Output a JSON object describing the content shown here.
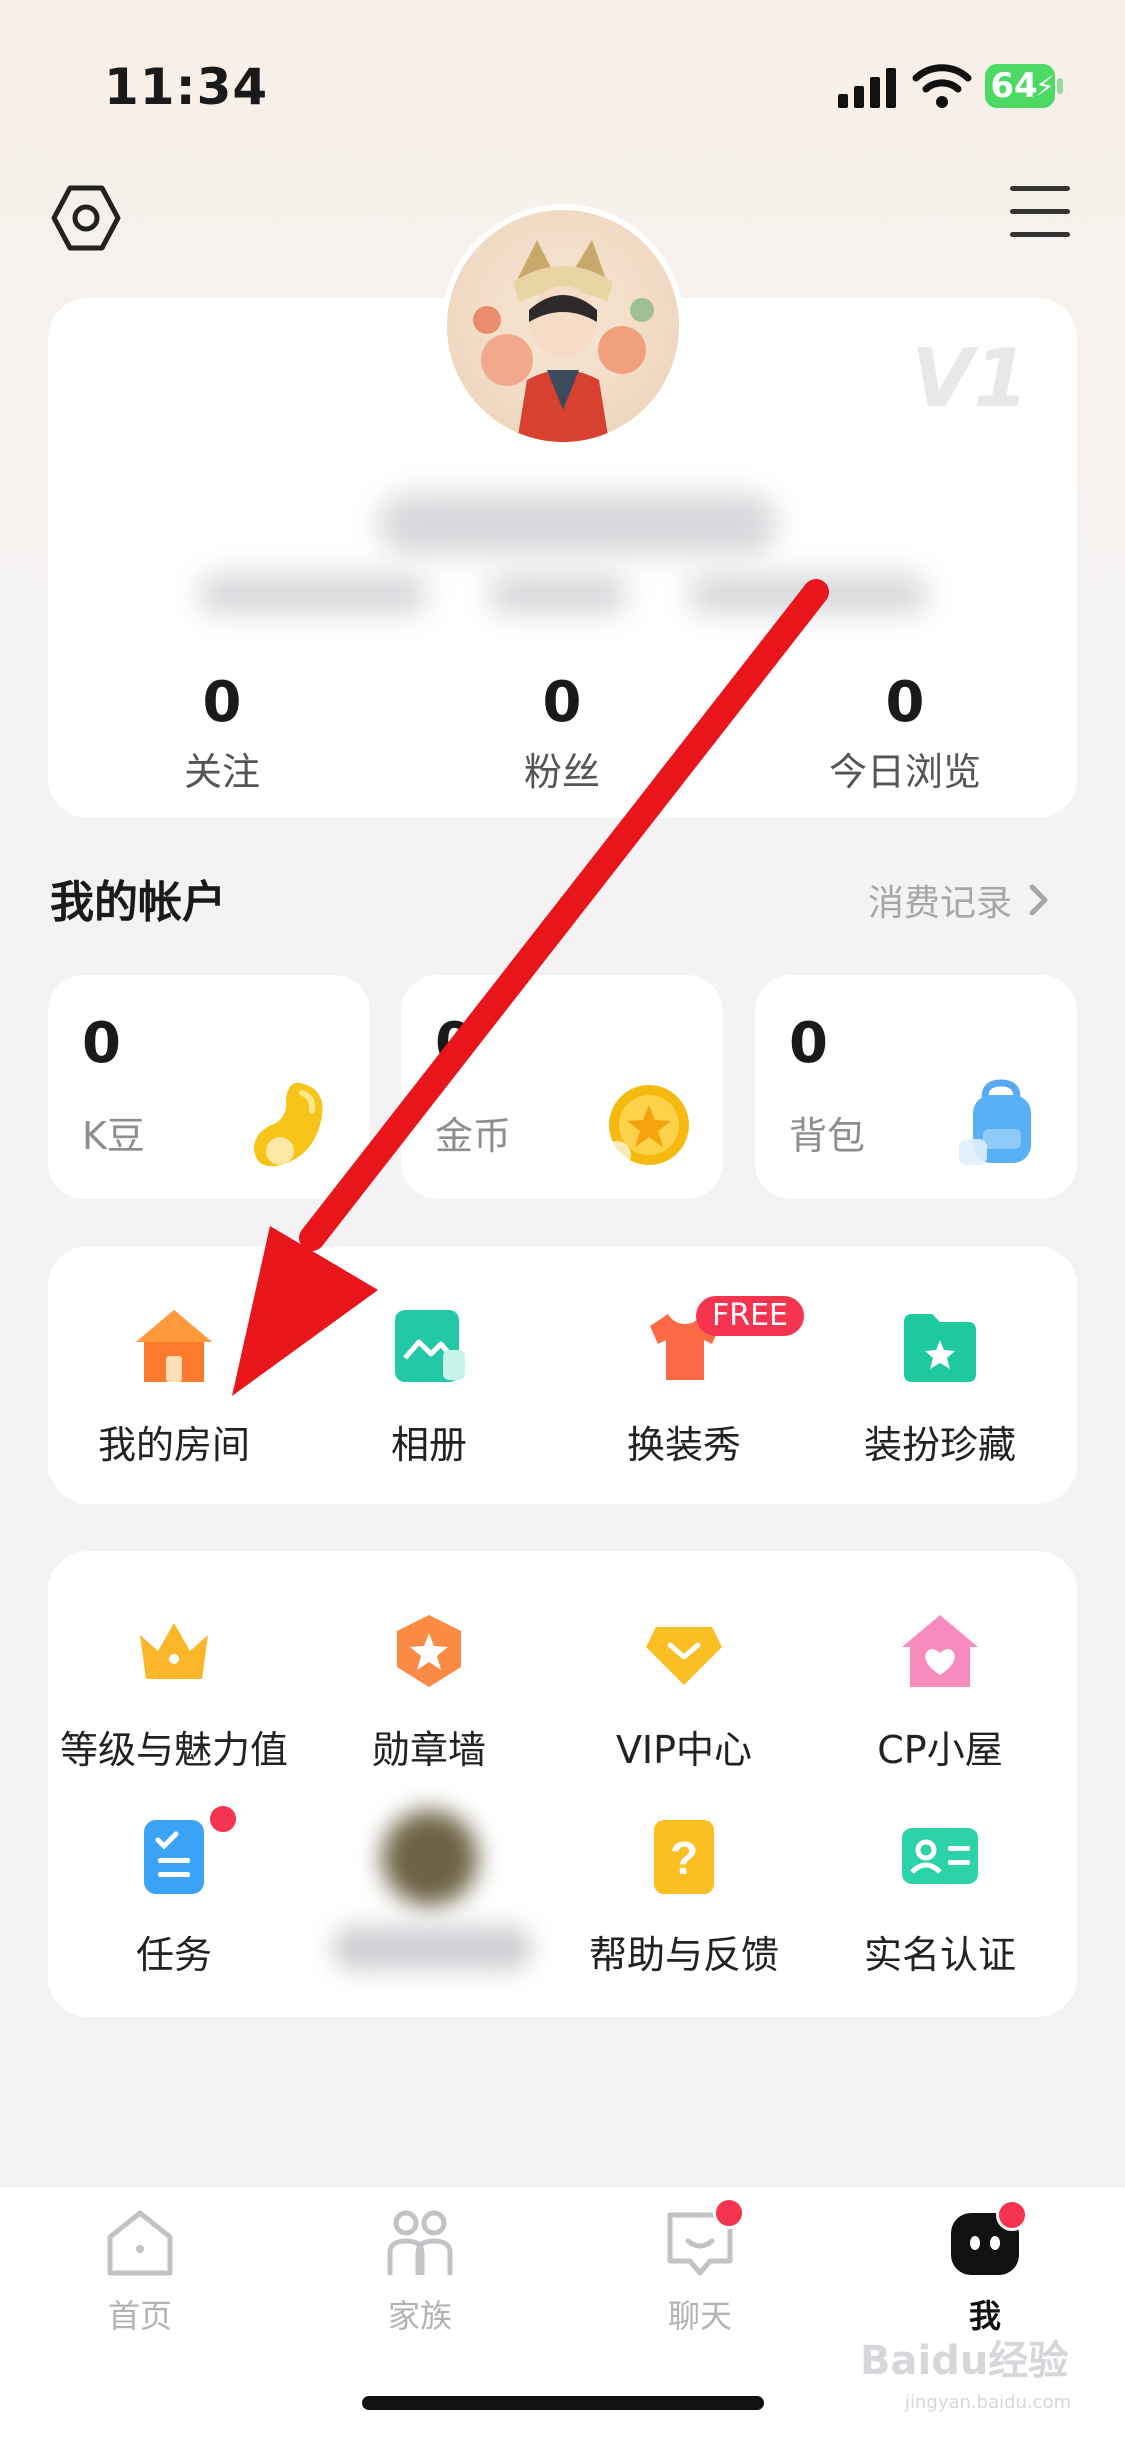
{
  "status_bar": {
    "time": "11:34",
    "battery": "64"
  },
  "profile": {
    "vip_level": "V1",
    "stats": [
      {
        "value": "0",
        "label": "关注"
      },
      {
        "value": "0",
        "label": "粉丝"
      },
      {
        "value": "0",
        "label": "今日浏览"
      }
    ]
  },
  "account": {
    "title": "我的帐户",
    "records_label": "消费记录",
    "balances": [
      {
        "value": "0",
        "label": "K豆",
        "icon": "bean-icon"
      },
      {
        "value": "0",
        "label": "金币",
        "icon": "gold-coin-icon"
      },
      {
        "value": "0",
        "label": "背包",
        "icon": "backpack-icon"
      }
    ]
  },
  "quick_actions": [
    {
      "label": "我的房间",
      "icon": "house-icon"
    },
    {
      "label": "相册",
      "icon": "photo-album-icon"
    },
    {
      "label": "换装秀",
      "icon": "tshirt-icon",
      "badge": "FREE"
    },
    {
      "label": "装扮珍藏",
      "icon": "folder-star-icon"
    }
  ],
  "services": [
    {
      "label": "等级与魅力值",
      "icon": "crown-icon"
    },
    {
      "label": "勋章墙",
      "icon": "medal-icon"
    },
    {
      "label": "VIP中心",
      "icon": "diamond-icon"
    },
    {
      "label": "CP小屋",
      "icon": "heart-house-icon"
    },
    {
      "label": "任务",
      "icon": "task-list-icon"
    },
    {
      "label": "帮助与反馈",
      "icon": "question-icon"
    },
    {
      "label": "实名认证",
      "icon": "id-card-icon"
    }
  ],
  "nav": [
    {
      "label": "首页",
      "icon": "home-icon"
    },
    {
      "label": "家族",
      "icon": "family-icon"
    },
    {
      "label": "聊天",
      "icon": "chat-icon"
    },
    {
      "label": "我",
      "icon": "me-icon"
    }
  ],
  "watermark": {
    "main": "Baidu经验",
    "sub": "jingyan.baidu.com"
  },
  "colors": {
    "accent_red": "#f5344f",
    "annotation_red": "#e8151b"
  }
}
